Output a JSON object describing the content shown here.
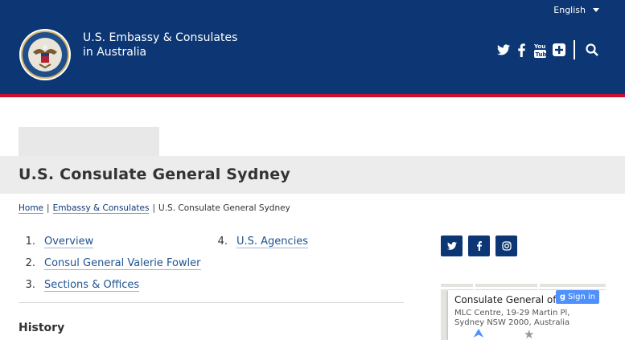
{
  "header": {
    "language": "English",
    "site_title_line1": "U.S. Embassy & Consulates",
    "site_title_line2": "in Australia",
    "icons": [
      "twitter-icon",
      "facebook-icon",
      "youtube-icon",
      "plus-icon",
      "search-icon"
    ],
    "colors": {
      "brand": "#0c3774",
      "stripe": "#c8102e"
    }
  },
  "page": {
    "title": "U.S. Consulate General Sydney"
  },
  "breadcrumb": {
    "home": "Home",
    "section": "Embassy & Consulates",
    "current": "U.S. Consulate General Sydney"
  },
  "toc": [
    {
      "num": "1.",
      "label": "Overview"
    },
    {
      "num": "2.",
      "label": "Consul General Valerie Fowler"
    },
    {
      "num": "3.",
      "label": "Sections & Offices"
    },
    {
      "num": "4.",
      "label": "U.S. Agencies"
    }
  ],
  "history_heading": "History",
  "social": [
    "twitter-icon",
    "facebook-icon",
    "instagram-icon"
  ],
  "map": {
    "place_name": "Consulate General of the Un",
    "address_line1": "MLC Centre, 19-29 Martin Pl,",
    "address_line2": "Sydney NSW 2000, Australia",
    "signin": "Sign in"
  }
}
